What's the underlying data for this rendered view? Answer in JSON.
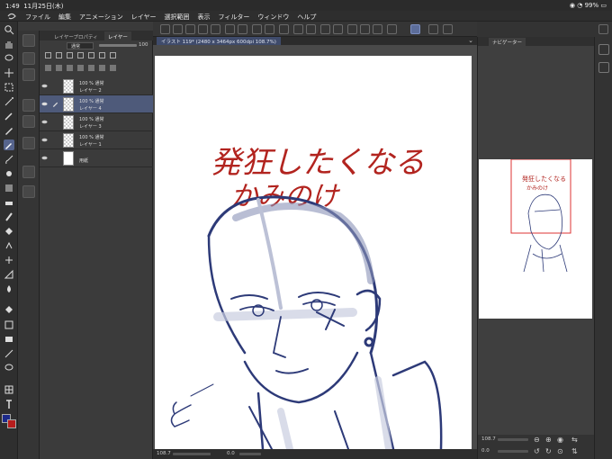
{
  "status": {
    "time": "1:49",
    "date": "11月25日(木)",
    "battery": "99%"
  },
  "menu": [
    "ファイル",
    "編集",
    "アニメーション",
    "レイヤー",
    "選択範囲",
    "表示",
    "フィルター",
    "ウィンドウ",
    "ヘルプ"
  ],
  "layer_panel": {
    "tabs": [
      "レイヤープロパティ",
      "レイヤー"
    ],
    "blend_mode": "通常",
    "opacity": "100",
    "layers": [
      {
        "line1": "100 % 通常",
        "line2": "レイヤー 2",
        "selected": false
      },
      {
        "line1": "100 % 通常",
        "line2": "レイヤー 4",
        "selected": true
      },
      {
        "line1": "100 % 通常",
        "line2": "レイヤー 3",
        "selected": false
      },
      {
        "line1": "100 % 通常",
        "line2": "レイヤー 1",
        "selected": false
      },
      {
        "line1": "",
        "line2": "用紙",
        "selected": false
      }
    ]
  },
  "document": {
    "tab_title": "イラスト 119* (2480 x 3464px 600dpi 108.7%)"
  },
  "canvas": {
    "text_line1": "発狂したくなる",
    "text_line2": "かみのけ"
  },
  "bottom_bar": {
    "zoom": "108.7",
    "rotation": "0.0"
  },
  "navigator": {
    "title": "ナビゲーター",
    "zoom": "108.7",
    "rotation": "0.0"
  },
  "colors": {
    "main": "#1c2a8a",
    "sub": "#b71d1d",
    "accent": "#56648d",
    "sketch": "#2d3a78",
    "text_red": "#b2241f"
  }
}
